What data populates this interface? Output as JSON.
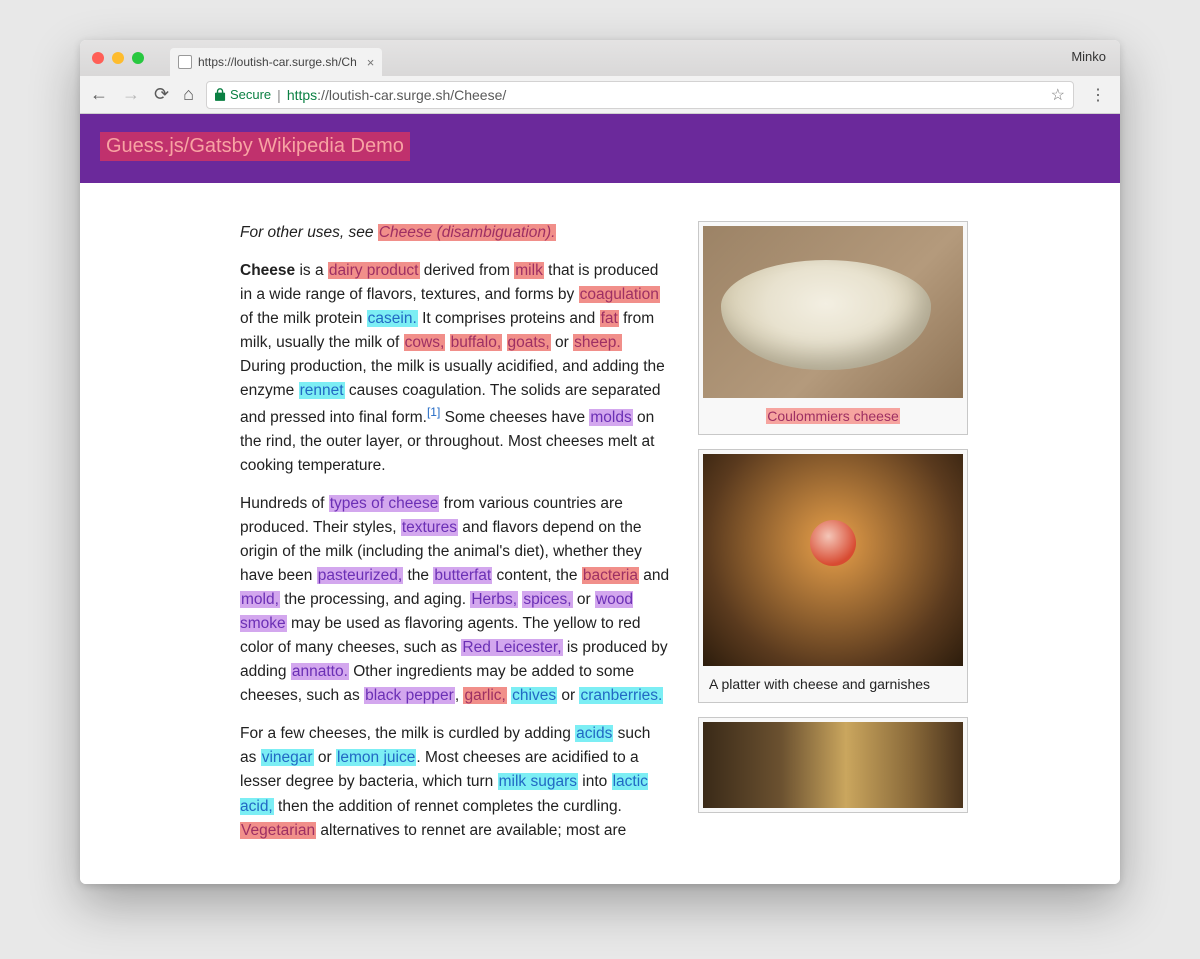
{
  "browser": {
    "profile": "Minko",
    "tab_title": "https://loutish-car.surge.sh/Ch",
    "secure_label": "Secure",
    "url_https": "https",
    "url_rest": "://loutish-car.surge.sh/Cheese/"
  },
  "header": {
    "title": "Guess.js/Gatsby Wikipedia Demo"
  },
  "hatnote": {
    "prefix": "For other uses, see ",
    "link": "Cheese (disambiguation).",
    "link_class": "c-pink"
  },
  "para1": {
    "bold": "Cheese",
    "t1": " is a ",
    "l1": {
      "text": "dairy product",
      "class": "c-pink"
    },
    "t2": " derived from ",
    "l2": {
      "text": "milk",
      "class": "c-pink"
    },
    "t3": " that is produced in a wide range of flavors, textures, and forms by ",
    "l3": {
      "text": "coagulation",
      "class": "c-pink"
    },
    "t4": " of the milk protein ",
    "l4": {
      "text": "casein.",
      "class": "c-cyan"
    },
    "t5": " It comprises proteins and ",
    "l5": {
      "text": "fat",
      "class": "c-pink"
    },
    "t6": " from milk, usually the milk of ",
    "l6": {
      "text": "cows,",
      "class": "c-pink"
    },
    "sp1": " ",
    "l7": {
      "text": "buffalo,",
      "class": "c-pink"
    },
    "sp2": " ",
    "l8": {
      "text": "goats,",
      "class": "c-pink"
    },
    "t7": " or ",
    "l9": {
      "text": "sheep.",
      "class": "c-pink"
    },
    "t8": " During production, the milk is usually acidified, and adding the enzyme ",
    "l10": {
      "text": "rennet",
      "class": "c-cyan"
    },
    "t9": " causes coagulation. The solids are separated and pressed into final form.",
    "ref": "[1]",
    "t10": " Some cheeses have ",
    "l11": {
      "text": "molds",
      "class": "c-purple"
    },
    "t11": " on the rind, the outer layer, or throughout. Most cheeses melt at cooking temperature."
  },
  "para2": {
    "t1": "Hundreds of ",
    "l1": {
      "text": "types of cheese",
      "class": "c-purple"
    },
    "t2": " from various countries are produced. Their styles, ",
    "l2": {
      "text": "textures",
      "class": "c-purple"
    },
    "t3": " and flavors depend on the origin of the milk (including the animal's diet), whether they have been ",
    "l3": {
      "text": "pasteurized,",
      "class": "c-purple"
    },
    "t4": " the ",
    "l4": {
      "text": "butterfat",
      "class": "c-purple"
    },
    "t5": " content, the ",
    "l5": {
      "text": "bacteria",
      "class": "c-pink"
    },
    "t6": " and ",
    "l6": {
      "text": "mold,",
      "class": "c-purple"
    },
    "t7": " the processing, and aging. ",
    "l7": {
      "text": "Herbs,",
      "class": "c-purple"
    },
    "sp1": " ",
    "l8": {
      "text": "spices,",
      "class": "c-purple"
    },
    "t8": " or ",
    "l9": {
      "text": "wood smoke",
      "class": "c-purple"
    },
    "t9": " may be used as flavoring agents. The yellow to red color of many cheeses, such as ",
    "l10": {
      "text": "Red Leicester,",
      "class": "c-purple"
    },
    "t10": " is produced by adding ",
    "l11": {
      "text": "annatto.",
      "class": "c-purple"
    },
    "t11": " Other ingredients may be added to some cheeses, such as ",
    "l12": {
      "text": "black pepper",
      "class": "c-purple"
    },
    "t12": ", ",
    "l13": {
      "text": "garlic,",
      "class": "c-pink"
    },
    "sp2": " ",
    "l14": {
      "text": "chives",
      "class": "c-cyan"
    },
    "t13": " or ",
    "l15": {
      "text": "cranberries.",
      "class": "c-cyan"
    }
  },
  "para3": {
    "t1": "For a few cheeses, the milk is curdled by adding ",
    "l1": {
      "text": "acids",
      "class": "c-cyan"
    },
    "t2": " such as ",
    "l2": {
      "text": "vinegar",
      "class": "c-cyan"
    },
    "t3": " or ",
    "l3": {
      "text": "lemon juice",
      "class": "c-cyan"
    },
    "t4": ". Most cheeses are acidified to a lesser degree by bacteria, which turn ",
    "l4": {
      "text": "milk sugars",
      "class": "c-cyan"
    },
    "t5": " into ",
    "l5": {
      "text": "lactic acid,",
      "class": "c-cyan"
    },
    "t6": " then the addition of rennet completes the curdling. ",
    "l6": {
      "text": "Vegetarian",
      "class": "c-pink"
    },
    "t7": " alternatives to rennet are available; most are"
  },
  "figures": {
    "f1_caption": "Coulommiers cheese",
    "f1_class": "c-pink-lt",
    "f2_caption": "A platter with cheese and garnishes"
  }
}
